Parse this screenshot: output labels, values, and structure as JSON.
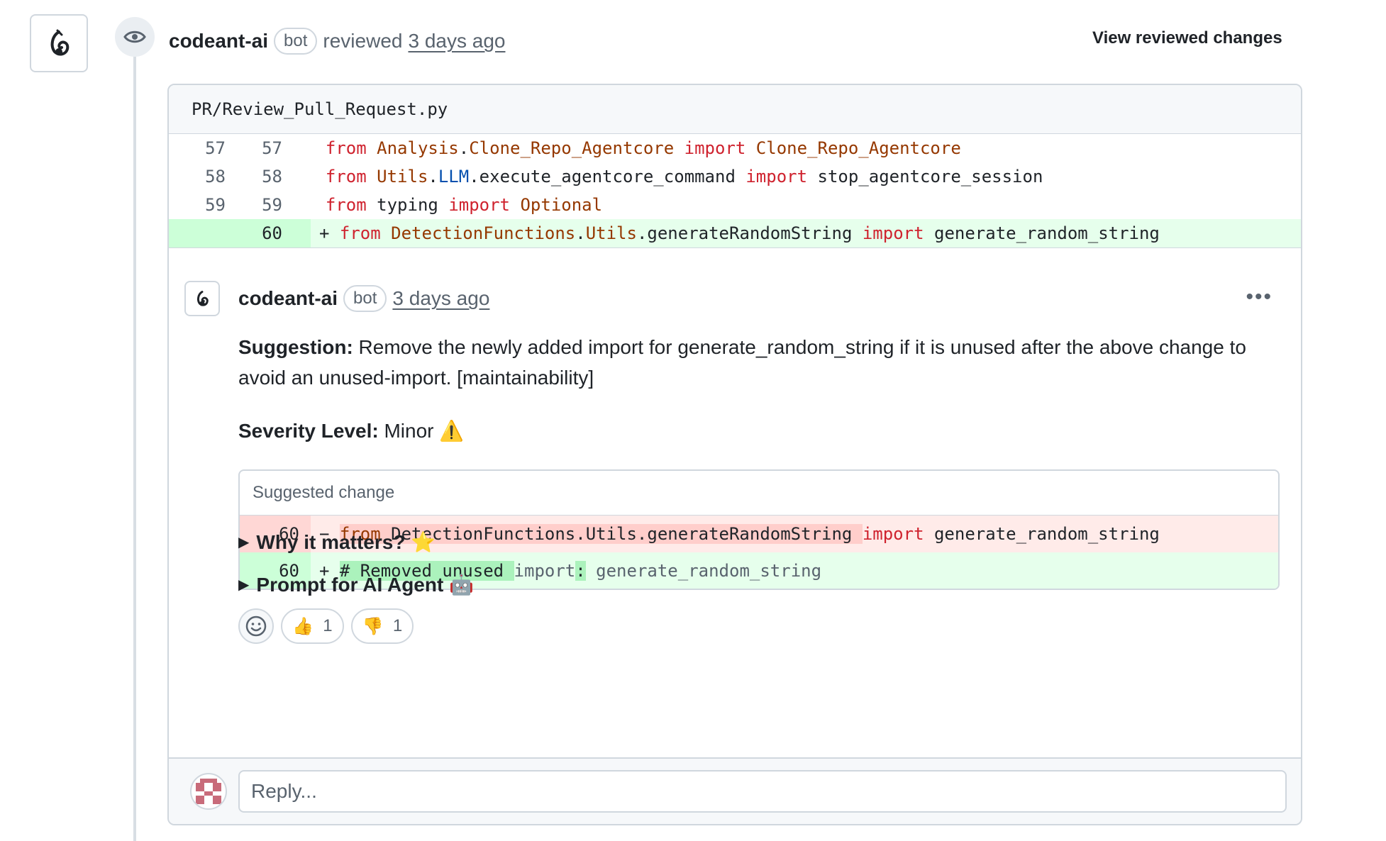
{
  "review": {
    "author": "codeant-ai",
    "badge": "bot",
    "action": "reviewed",
    "time": "3 days ago",
    "view_changes": "View reviewed changes"
  },
  "file": {
    "path": "PR/Review_Pull_Request.py",
    "lines": [
      {
        "old": "57",
        "new": "57"
      },
      {
        "old": "58",
        "new": "58"
      },
      {
        "old": "59",
        "new": "59"
      },
      {
        "old": "",
        "new": "60",
        "marker": "+"
      }
    ]
  },
  "comment": {
    "author": "codeant-ai",
    "badge": "bot",
    "time": "3 days ago",
    "menu": "•••",
    "suggestion_label": "Suggestion:",
    "suggestion_text": " Remove the newly added import for generate_random_string if it is unused after the above change to avoid an unused-import. [maintainability]",
    "severity_label": "Severity Level:",
    "severity_value": " Minor ",
    "severity_icon": "⚠️",
    "suggested_change": {
      "header": "Suggested change",
      "del_line_no": "60",
      "add_line_no": "60",
      "del_marker": "−",
      "add_marker": "+"
    },
    "why_matters": "Why it matters? ⭐",
    "prompt_agent": "Prompt for AI Agent 🤖",
    "reactions": [
      {
        "emoji": "👍",
        "count": "1"
      },
      {
        "emoji": "👎",
        "count": "1"
      }
    ]
  },
  "reply": {
    "placeholder": "Reply..."
  },
  "colors": {
    "added_bg": "#e6ffec",
    "added_gutter": "#ccffd8",
    "deleted_bg": "#ffebe9",
    "deleted_gutter": "#ffd7d5",
    "keyword": "#cf222e",
    "module": "#953800",
    "border": "#d0d7de"
  }
}
